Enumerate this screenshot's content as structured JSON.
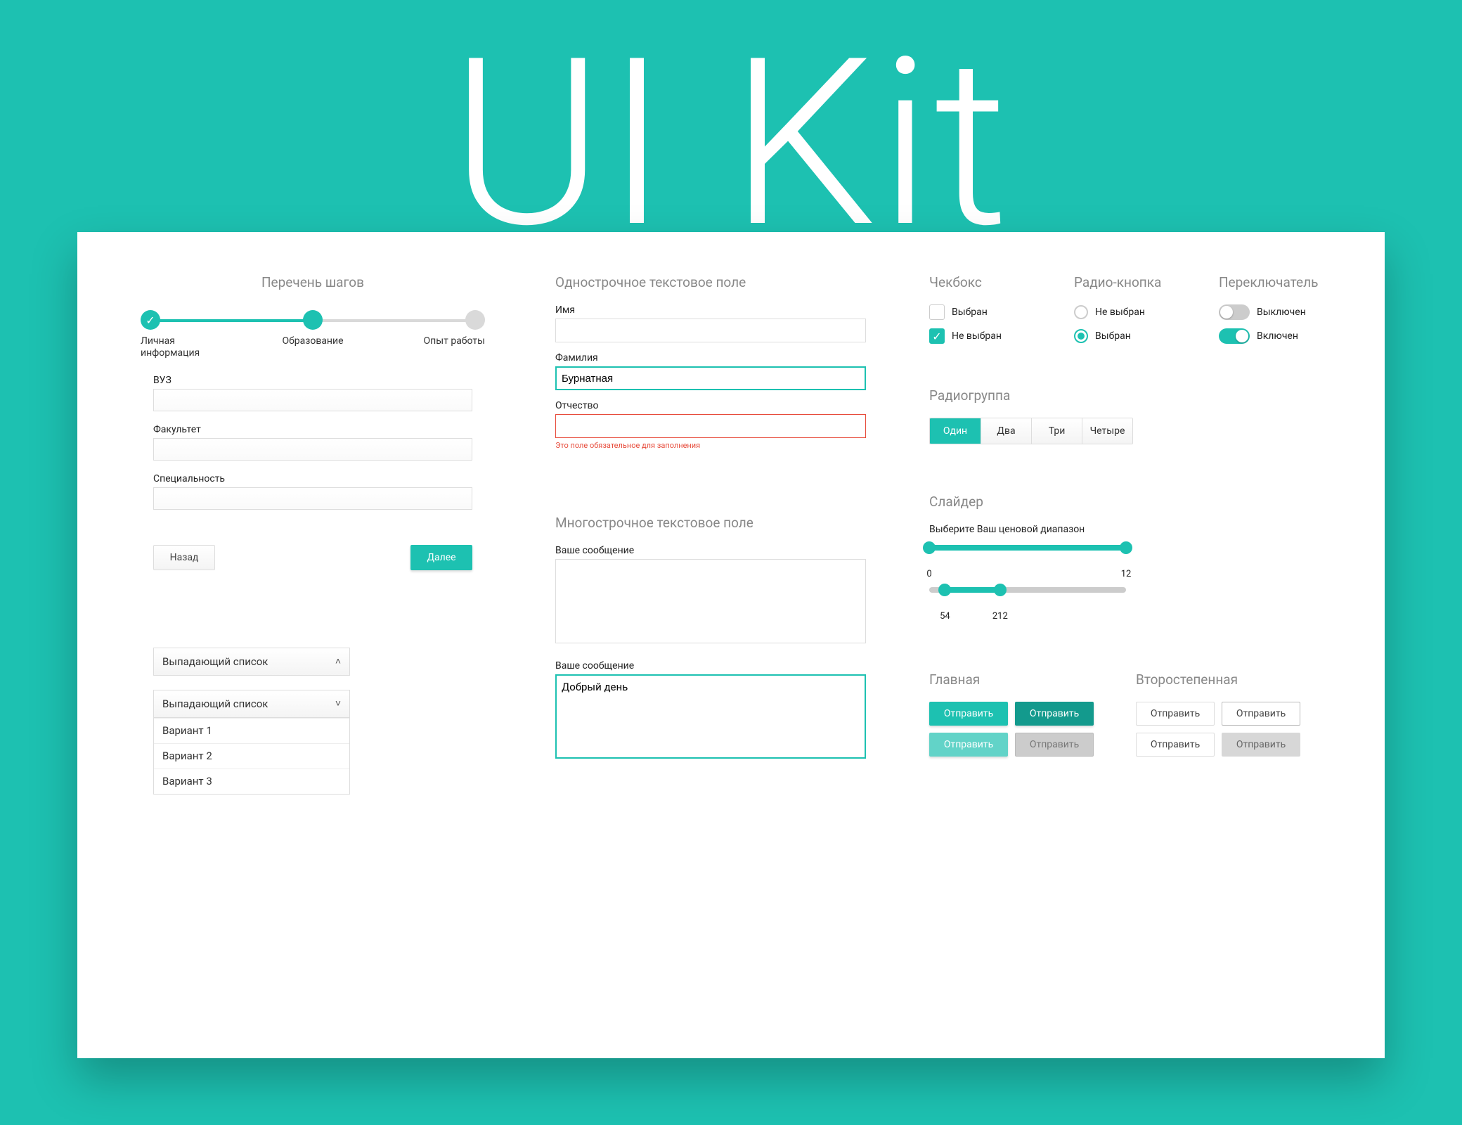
{
  "hero": {
    "title": "UI Kit"
  },
  "stepper": {
    "title": "Перечень шагов",
    "steps": [
      "Личная информация",
      "Образование",
      "Опыт работы"
    ]
  },
  "form": {
    "field1": "ВУЗ",
    "field2": "Факультет",
    "field3": "Специальность",
    "back": "Назад",
    "next": "Далее"
  },
  "dropdown": {
    "label": "Выпадающий список",
    "options": [
      "Вариант 1",
      "Вариант 2",
      "Вариант 3"
    ]
  },
  "textfield": {
    "title": "Однострочное текстовое поле",
    "name_label": "Имя",
    "surname_label": "Фамилия",
    "surname_value": "Бурнатная",
    "patronymic_label": "Отчество",
    "error_msg": "Это поле обязательное для заполнения"
  },
  "multiline": {
    "title": "Многострочное текстовое поле",
    "label": "Ваше сообщение",
    "value": "Добрый день"
  },
  "checkbox": {
    "title": "Чекбокс",
    "opt_checked": "Выбран",
    "opt_unchecked": "Не выбран"
  },
  "radio": {
    "title": "Радио-кнопка",
    "opt_unchecked": "Не выбран",
    "opt_checked": "Выбран"
  },
  "toggle": {
    "title": "Переключатель",
    "off": "Выключен",
    "on": "Включен"
  },
  "radiogroup": {
    "title": "Радиогруппа",
    "options": [
      "Один",
      "Два",
      "Три",
      "Четыре"
    ]
  },
  "slider": {
    "title": "Слайдер",
    "label": "Выберите Ваш ценовой диапазон",
    "range1": {
      "min": 0,
      "max": 12,
      "from": 0,
      "to": 12
    },
    "range2": {
      "from": 54,
      "to": 212,
      "track_min": 0,
      "track_max": 360
    }
  },
  "buttons": {
    "primary_title": "Главная",
    "secondary_title": "Второстепенная",
    "label": "Отправить"
  }
}
